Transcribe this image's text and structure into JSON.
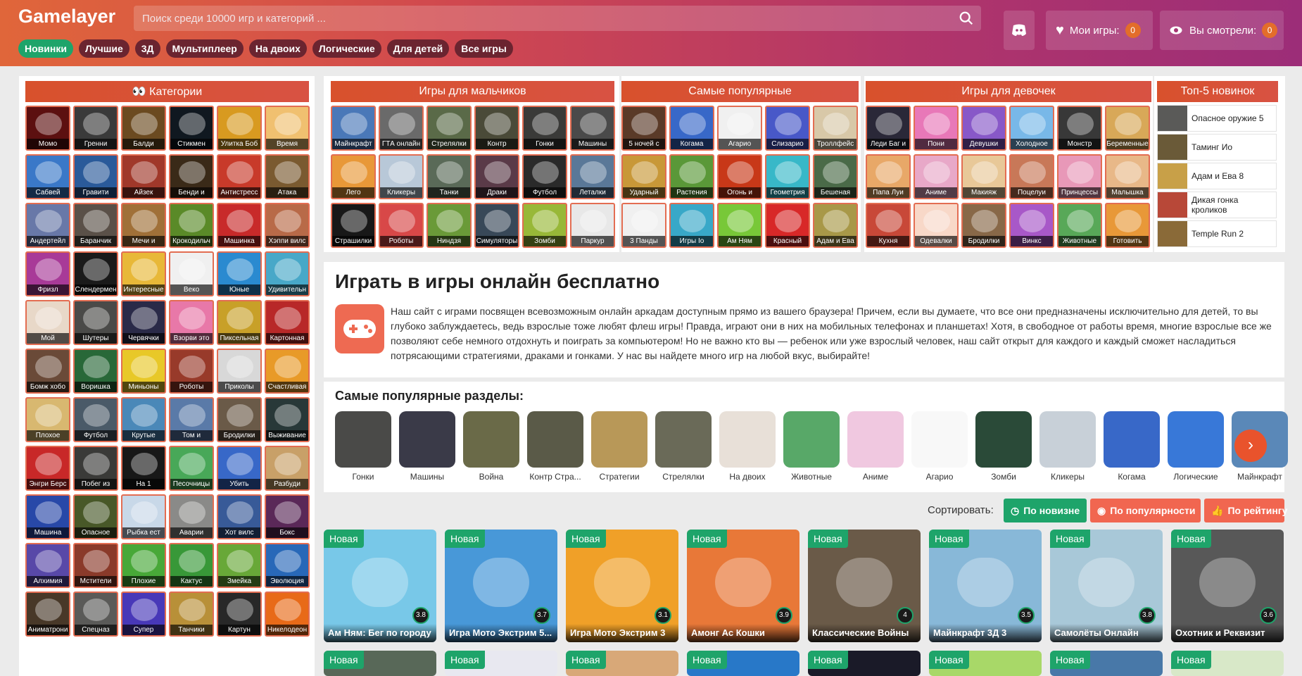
{
  "header": {
    "logo": "Gamelayer",
    "search_placeholder": "Поиск среди 10000 игр и категорий ...",
    "nav": [
      "Новинки",
      "Лучшие",
      "3Д",
      "Мультиплеер",
      "На двоих",
      "Логические",
      "Для детей",
      "Все игры"
    ],
    "my_games_label": "Мои игры:",
    "my_games_count": "0",
    "watched_label": "Вы смотрели:",
    "watched_count": "0"
  },
  "sidebar": {
    "title": "👀 Категории",
    "items": [
      "Момо",
      "Гренни",
      "Балди",
      "Стикмен",
      "Улитка Боб",
      "Время",
      "Сабвей",
      "Гравити",
      "Айзек",
      "Бенди и",
      "Антистресс",
      "Атака",
      "Андертейл",
      "Баранчик",
      "Мечи и",
      "Крокодильч",
      "Машинка",
      "Хэппи вилс",
      "Фризл",
      "Слендермен",
      "Интересные",
      "Веко",
      "Юные",
      "Удивительн",
      "Мой",
      "Шутеры",
      "Червячки",
      "Взорви это",
      "Пиксельная",
      "Картонная",
      "Бомж хобо",
      "Воришка",
      "Миньоны",
      "Роботы",
      "Приколы",
      "Счастливая",
      "Плохое",
      "Футбол",
      "Крутые",
      "Том и",
      "Бродилки",
      "Выживание",
      "Энгри Берс",
      "Побег из",
      "На 1",
      "Песочницы",
      "Убить",
      "Разбуди",
      "Машина",
      "Опасное",
      "Рыбка ест",
      "Аварии",
      "Хот вилс",
      "Бокс",
      "Алхимия",
      "Мстители",
      "Плохие",
      "Кактус",
      "Змейка",
      "Эволюция",
      "Аниматрони",
      "Спецназ",
      "Супер",
      "Танчики",
      "Картун",
      "Никелодеон"
    ],
    "colors": [
      "#5c1010",
      "#3a3a3a",
      "#6b4a20",
      "#101820",
      "#d89a20",
      "#f0c070",
      "#3a78c8",
      "#2a5a9a",
      "#a0382a",
      "#3a2a18",
      "#c83a2a",
      "#7a5a30",
      "#6878a8",
      "#5a5048",
      "#a07038",
      "#5a8a28",
      "#c82a2a",
      "#b86a48",
      "#a83a98",
      "#1a1a1a",
      "#e8b838",
      "#f0f0f0",
      "#2a8ad0",
      "#48a8c8",
      "#e8d8c8",
      "#4a4a48",
      "#2a2a48",
      "#e878a8",
      "#c8a028",
      "#b82828",
      "#6a4a38",
      "#286838",
      "#e8c828",
      "#983a2a",
      "#d8d8d8",
      "#e89a28",
      "#d8b870",
      "#4a5a68",
      "#4a88b8",
      "#5a7aa8",
      "#6a5a48",
      "#283838",
      "#c82828",
      "#3a3a38",
      "#181818",
      "#48a858",
      "#3868c8",
      "#c8a068",
      "#2848a8",
      "#485828",
      "#c8d8e8",
      "#8a8a88",
      "#385a98",
      "#5a2858",
      "#5848a8",
      "#8a3a2a",
      "#48a838",
      "#389838",
      "#68a838",
      "#2868b8",
      "#483828",
      "#5a5a58",
      "#4838b8",
      "#b89038",
      "#282828",
      "#e86a18"
    ]
  },
  "boys": {
    "title": "Игры для мальчиков",
    "items": [
      "Майнкрафт",
      "ГТА онлайн",
      "Стрелялки",
      "Контр",
      "Гонки",
      "Машины",
      "Лего",
      "Кликеры",
      "Танки",
      "Драки",
      "Футбол",
      "Леталки",
      "Страшилки",
      "Роботы",
      "Ниндзя",
      "Симуляторы",
      "Зомби",
      "Паркур"
    ],
    "colors": [
      "#4a78b8",
      "#6a6a6a",
      "#5a6a48",
      "#4a4a38",
      "#3a3a38",
      "#4a4a4a",
      "#e89838",
      "#b8c8d8",
      "#5a6a58",
      "#5a3a48",
      "#2a2a2a",
      "#5a7898",
      "#181818",
      "#d84848",
      "#6a9a38",
      "#384858",
      "#98b838",
      "#e8e8e8"
    ]
  },
  "popular": {
    "title": "Самые популярные",
    "items": [
      "5 ночей с",
      "Когама",
      "Агарио",
      "Слизарио",
      "Троллфейс",
      "Ударный",
      "Растения",
      "Огонь и",
      "Геометрия",
      "Бешеная",
      "3 Панды",
      "Игры Io",
      "Ам Ням",
      "Красный",
      "Адам и Ева"
    ],
    "colors": [
      "#5a3a28",
      "#3868c8",
      "#f0f0f0",
      "#4858c8",
      "#d8c8a8",
      "#c89838",
      "#5a9838",
      "#c83818",
      "#38b8c8",
      "#4a6a48",
      "#f0f0f0",
      "#38a8c8",
      "#78c838",
      "#d82828",
      "#a89848"
    ]
  },
  "girls": {
    "title": "Игры для девочек",
    "items": [
      "Леди Баг и",
      "Пони",
      "Девушки",
      "Холодное",
      "Монстр",
      "Беременные",
      "Папа Луи",
      "Аниме",
      "Макияж",
      "Поцелуи",
      "Принцессы",
      "Малышка",
      "Кухня",
      "Одевалки",
      "Бродилки",
      "Винкс",
      "Животные",
      "Готовить"
    ],
    "colors": [
      "#2a2838",
      "#e878b8",
      "#8858c8",
      "#78b8e8",
      "#383838",
      "#d8a858",
      "#e8a868",
      "#e8a8c8",
      "#e8c898",
      "#c87858",
      "#e898b8",
      "#e8b888",
      "#c84838",
      "#f8d8c8",
      "#886848",
      "#a858c8",
      "#58a858",
      "#e89838"
    ]
  },
  "top5": {
    "title": "Топ-5 новинок",
    "items": [
      "Опасное оружие 5",
      "Таминг Ио",
      "Адам и Ева 8",
      "Дикая гонка кроликов",
      "Temple Run 2"
    ],
    "colors": [
      "#5a5a58",
      "#6a5a38",
      "#c8a048",
      "#b84838",
      "#8a6a38"
    ]
  },
  "about": {
    "title": "Играть в игры онлайн бесплатно",
    "text": "Наш сайт с играми посвящен всевозможным онлайн аркадам доступным прямо из вашего браузера! Причем, если вы думаете, что все они предназначены исключительно для детей, то вы глубоко заблуждаетесь, ведь взрослые тоже любят флеш игры! Правда, играют они в них на мобильных телефонах и планшетах! Хотя, в свободное от работы время, многие взрослые все же позволяют себе немного отдохнуть и поиграть за компьютером! Но не важно кто вы — ребенок или уже взрослый человек, наш сайт открыт для каждого и каждый сможет насладиться потрясающими стратегиями, драками и гонками. У нас вы найдете много игр на любой вкус, выбирайте!"
  },
  "sections": {
    "title": "Самые популярные разделы:",
    "items": [
      "Гонки",
      "Машины",
      "Война",
      "Контр Стра...",
      "Стратегии",
      "Стрелялки",
      "На двоих",
      "Животные",
      "Аниме",
      "Агарио",
      "Зомби",
      "Кликеры",
      "Когама",
      "Логические",
      "Майнкрафт"
    ],
    "colors": [
      "#4a4a48",
      "#3a3a48",
      "#6a6a48",
      "#5a5a48",
      "#b89858",
      "#6a6a58",
      "#e8e0d8",
      "#58a868",
      "#f0c8e0",
      "#f8f8f8",
      "#2a4a38",
      "#c8d0d8",
      "#3868c8",
      "#3878d8",
      "#5a88b8"
    ]
  },
  "sort": {
    "label": "Сортировать:",
    "by_new": "По новизне",
    "by_popular": "По популярности",
    "by_rating": "По рейтингу"
  },
  "cards": {
    "badge": "Новая",
    "items": [
      {
        "title": "Ам Ням: Бег по городу",
        "rating": "3.8",
        "color": "#78c8e8"
      },
      {
        "title": "Игра Мото Экстрим 5...",
        "rating": "3.7",
        "color": "#4898d8"
      },
      {
        "title": "Игра Мото Экстрим 3",
        "rating": "3.1",
        "color": "#f0a028"
      },
      {
        "title": "Амонг Ас Кошки",
        "rating": "3.9",
        "color": "#e87838"
      },
      {
        "title": "Классические Войны",
        "rating": "4",
        "color": "#6a5a48"
      },
      {
        "title": "Майнкрафт 3Д 3",
        "rating": "3.5",
        "color": "#88b8d8"
      },
      {
        "title": "Самолёты Онлайн",
        "rating": "3.8",
        "color": "#a8c8d8"
      },
      {
        "title": "Охотник и Реквизит",
        "rating": "3.6",
        "color": "#585858"
      }
    ],
    "row2_colors": [
      "#586858",
      "#e8e8f0",
      "#d8a878",
      "#2878c8",
      "#1a1a28",
      "#a8d868",
      "#4878a8",
      "#d8e8c8"
    ]
  }
}
